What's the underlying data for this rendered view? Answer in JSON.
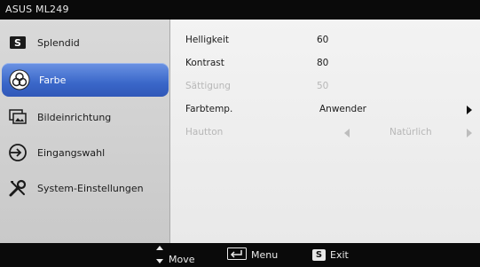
{
  "window": {
    "title": "ASUS ML249"
  },
  "sidebar": {
    "items": [
      {
        "label": "Splendid",
        "icon": "splendid-s-icon"
      },
      {
        "label": "Farbe",
        "icon": "color-circles-icon",
        "selected": true
      },
      {
        "label": "Bildeinrichtung",
        "icon": "image-setup-icon"
      },
      {
        "label": "Eingangswahl",
        "icon": "input-select-icon"
      },
      {
        "label": "System-Einstellungen",
        "icon": "wrench-screwdriver-icon"
      }
    ]
  },
  "settings": [
    {
      "label": "Helligkeit",
      "value": "60"
    },
    {
      "label": "Kontrast",
      "value": "80"
    },
    {
      "label": "Sättigung",
      "value": "50",
      "disabled": true
    },
    {
      "label": "Farbtemp.",
      "value": "Anwender"
    },
    {
      "label": "Hautton",
      "value": "Natürlich",
      "disabled": true
    }
  ],
  "footer": {
    "move_label": "Move",
    "menu_label": "Menu",
    "exit_label": "Exit",
    "exit_key": "S"
  },
  "colors": {
    "selected_bg": "#3a67c9",
    "sidebar_bg": "#d0d0d0",
    "content_bg": "#efefef",
    "bar_bg": "#0a0a0a"
  }
}
